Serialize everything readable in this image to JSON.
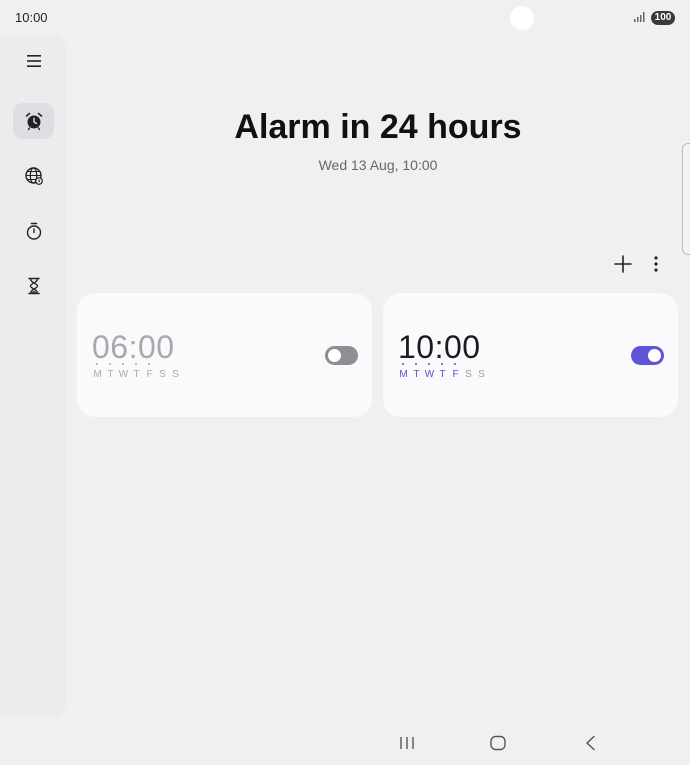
{
  "status": {
    "time": "10:00",
    "battery": "100"
  },
  "rail": [
    {
      "name": "menu-icon"
    },
    {
      "name": "alarm-icon",
      "active": true
    },
    {
      "name": "world-clock-icon"
    },
    {
      "name": "stopwatch-icon"
    },
    {
      "name": "timer-icon"
    }
  ],
  "header": {
    "title": "Alarm in 24 hours",
    "subtitle": "Wed 13 Aug, 10:00"
  },
  "toolbar": {
    "add_icon": "plus-icon",
    "more_icon": "more-vertical-icon"
  },
  "alarms": [
    {
      "time": "06:00",
      "enabled": false,
      "days": [
        "M",
        "T",
        "W",
        "T",
        "F",
        "S",
        "S"
      ],
      "active_days": [
        0,
        1,
        2,
        3,
        4
      ]
    },
    {
      "time": "10:00",
      "enabled": true,
      "days": [
        "M",
        "T",
        "W",
        "T",
        "F",
        "S",
        "S"
      ],
      "active_days": [
        0,
        1,
        2,
        3,
        4
      ]
    }
  ],
  "colors": {
    "accent": "#5f55d6",
    "off": "#8e8e93",
    "background": "#f0f0f2",
    "card": "#fafafc"
  }
}
